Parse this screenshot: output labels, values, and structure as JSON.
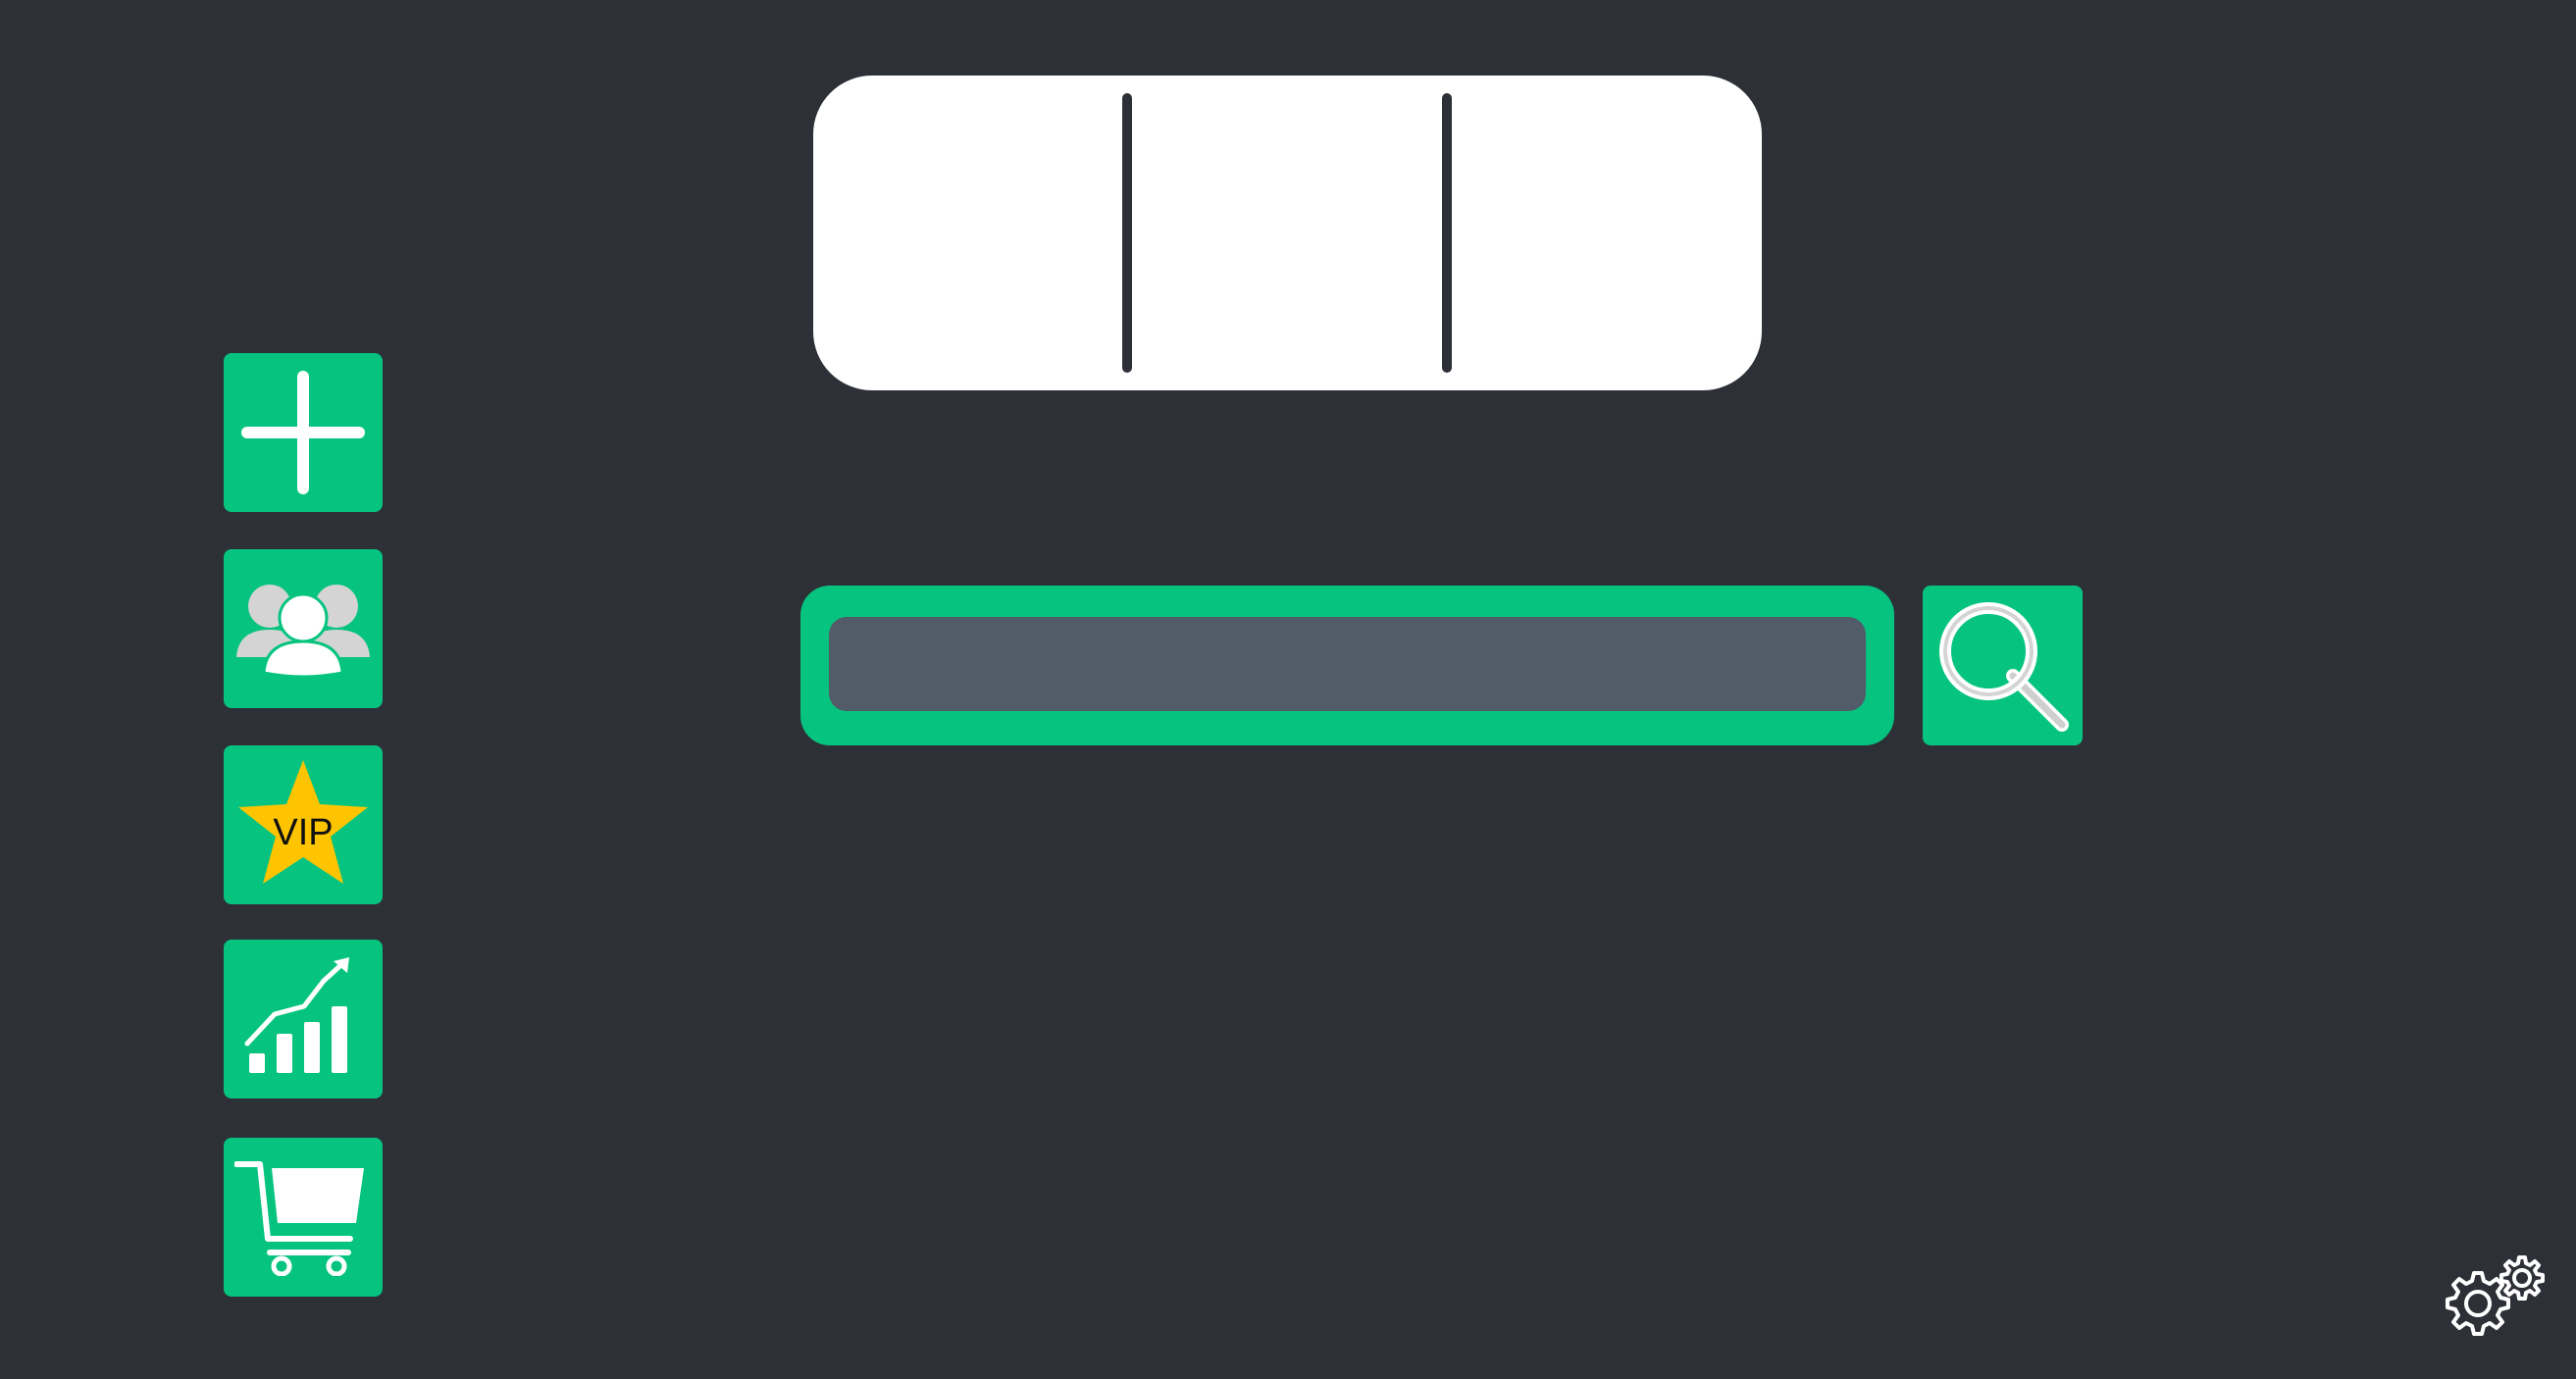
{
  "display": {
    "segments": [
      "",
      "",
      ""
    ]
  },
  "search": {
    "value": "",
    "placeholder": ""
  },
  "toolbar": {
    "items": [
      {
        "icon": "plus-icon"
      },
      {
        "icon": "users-icon"
      },
      {
        "icon": "vip-star-icon",
        "label": "VIP"
      },
      {
        "icon": "growth-chart-icon"
      },
      {
        "icon": "shopping-cart-icon"
      }
    ]
  },
  "colors": {
    "background": "#2e3038",
    "accent": "#06c47f",
    "input": "#525c68",
    "star": "#ffc400"
  }
}
